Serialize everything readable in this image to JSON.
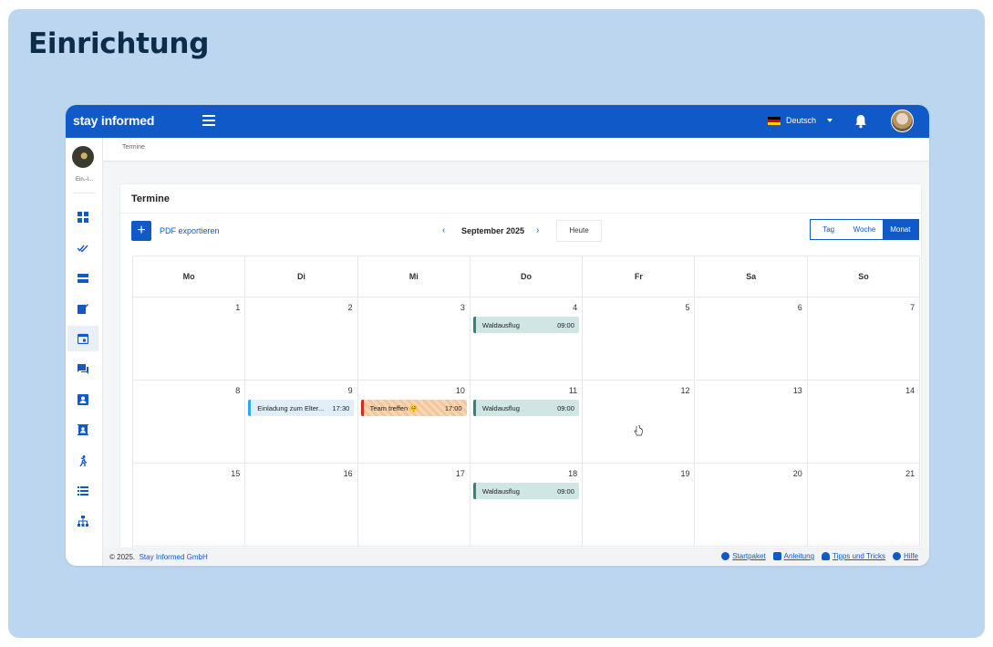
{
  "heading": "Einrichtung",
  "app": {
    "logo": "stay informed",
    "language": "Deutsch",
    "sidebar_label": "Ein.-I...",
    "breadcrumb": "Termine"
  },
  "calendar": {
    "title": "Termine",
    "pdf_export": "PDF exportieren",
    "add_symbol": "+",
    "prev": "‹",
    "next": "›",
    "month": "September 2025",
    "today": "Heute",
    "views": [
      "Tag",
      "Woche",
      "Monat"
    ],
    "selected_view": "Monat",
    "weekdays": [
      "Mo",
      "Di",
      "Mi",
      "Do",
      "Fr",
      "Sa",
      "So"
    ],
    "weeks": [
      [
        "1",
        "2",
        "3",
        "4",
        "5",
        "6",
        "7"
      ],
      [
        "8",
        "9",
        "10",
        "11",
        "12",
        "13",
        "14"
      ],
      [
        "15",
        "16",
        "17",
        "18",
        "19",
        "20",
        "21"
      ]
    ],
    "events": [
      {
        "week": 0,
        "day": 3,
        "title": "Waldausflug",
        "time": "09:00",
        "style": "green"
      },
      {
        "week": 1,
        "day": 1,
        "title": "Einladung zum Elter...",
        "time": "17:30",
        "style": "blue"
      },
      {
        "week": 1,
        "day": 2,
        "title": "Team treffen 🤗",
        "time": "17:00",
        "style": "orange"
      },
      {
        "week": 1,
        "day": 3,
        "title": "Waldausflug",
        "time": "09:00",
        "style": "green"
      },
      {
        "week": 2,
        "day": 3,
        "title": "Waldausflug",
        "time": "09:00",
        "style": "green"
      }
    ]
  },
  "footer": {
    "copyright": "© 2025.",
    "company": "Stay Informed GmbH",
    "links": [
      "Startpaket",
      "Anleitung",
      "Tipps und Tricks",
      "Hilfe"
    ]
  },
  "colors": {
    "primary": "#1059c9",
    "background": "#bcd6f0",
    "heading": "#0c2d4a"
  }
}
